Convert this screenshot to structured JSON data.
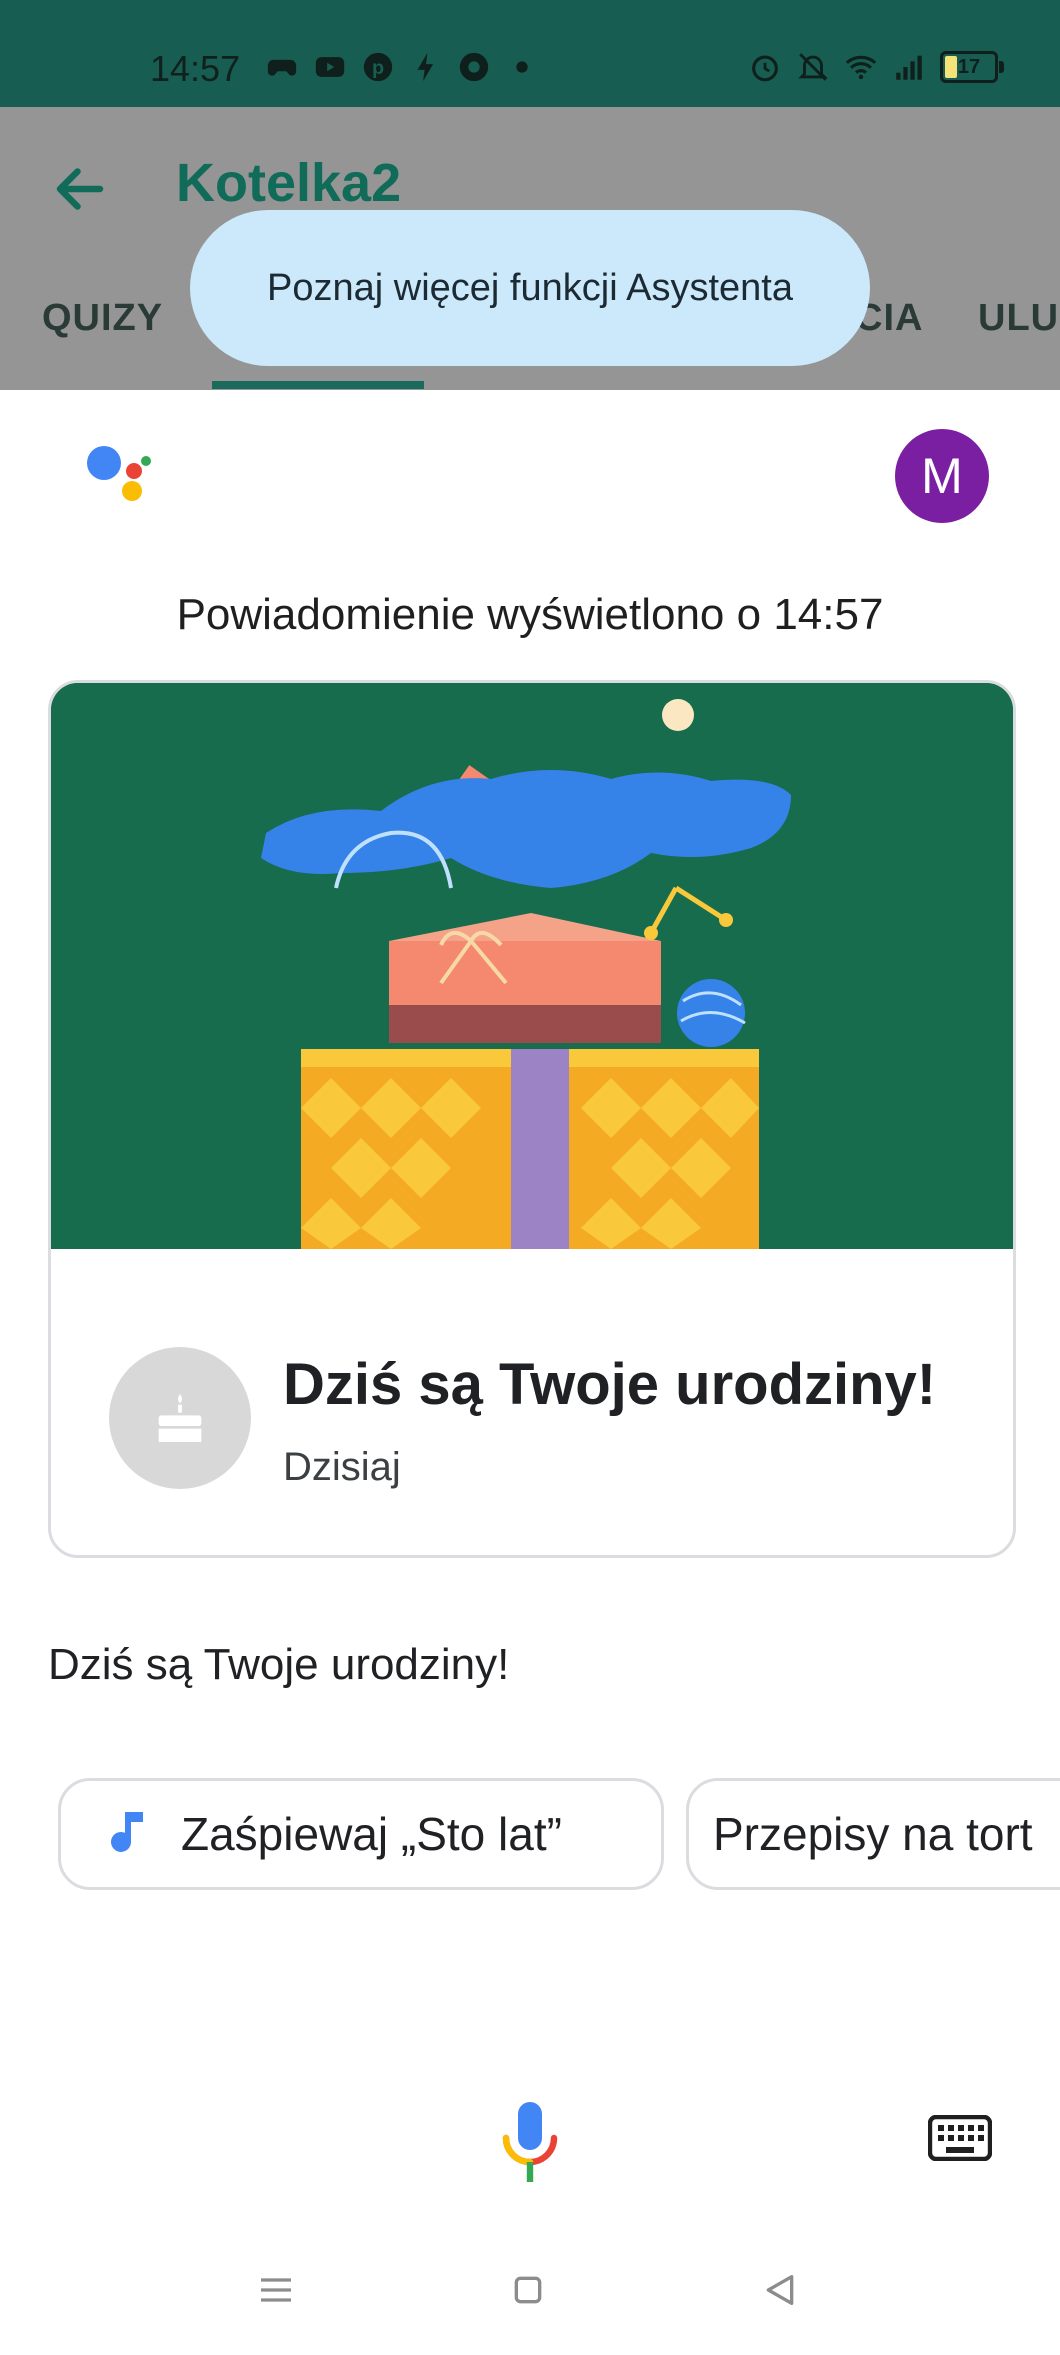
{
  "status_bar": {
    "time": "14:57",
    "battery_level": "17",
    "left_icons": [
      "game-controller-icon",
      "youtube-icon",
      "pinterest-icon",
      "bolt-icon",
      "chrome-icon",
      "dot-icon"
    ],
    "right_icons": [
      "alarm-icon",
      "bell-off-icon",
      "wifi-icon",
      "signal-icon",
      "battery-icon"
    ]
  },
  "app": {
    "title": "Kotelka2",
    "tabs": [
      "QUIZY",
      "CIA",
      "ULU"
    ]
  },
  "tooltip": {
    "text": "Poznaj więcej funkcji Asystenta"
  },
  "assistant": {
    "avatar_letter": "M",
    "notification_time": "Powiadomienie wyświetlono o 14:57",
    "card": {
      "title": "Dziś są Twoje urodziny!",
      "subtitle": "Dzisiaj"
    },
    "reply": "Dziś są Twoje urodziny!",
    "chips": [
      "Zaśpiewaj „Sto lat”",
      "Przepisy na tort"
    ]
  },
  "colors": {
    "status_bar": "#175d52",
    "accent": "#116b59",
    "illustration_bg": "#176c4d",
    "avatar": "#7b1fa2",
    "tooltip": "#cce8fb"
  }
}
